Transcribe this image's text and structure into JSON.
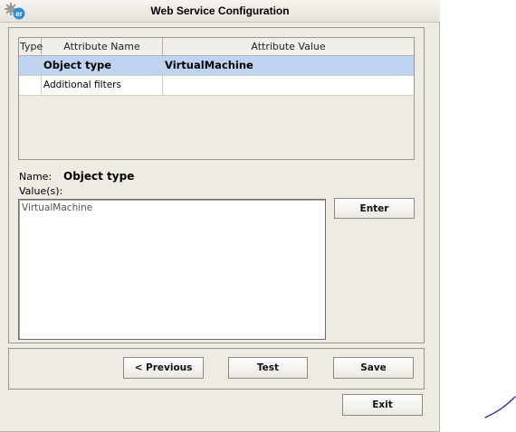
{
  "window": {
    "title": "Web Service Configuration",
    "icon": "app-logo-icon"
  },
  "table": {
    "columns": [
      "Type",
      "Attribute Name",
      "Attribute Value"
    ],
    "rows": [
      {
        "type": "",
        "name": "Object type",
        "value": "VirtualMachine",
        "selected": true
      },
      {
        "type": "",
        "name": "Additional filters",
        "value": "",
        "selected": false
      }
    ]
  },
  "detail": {
    "name_label": "Name:",
    "name_value": "Object type",
    "values_label": "Value(s):",
    "values_text": "VirtualMachine"
  },
  "buttons": {
    "enter": "Enter",
    "previous": "< Previous",
    "test": "Test",
    "save": "Save",
    "exit": "Exit"
  },
  "colors": {
    "window_bg": "#eeebe4",
    "selected_row": "#bfd3f3",
    "annotation_stroke": "#1b2fa3"
  }
}
